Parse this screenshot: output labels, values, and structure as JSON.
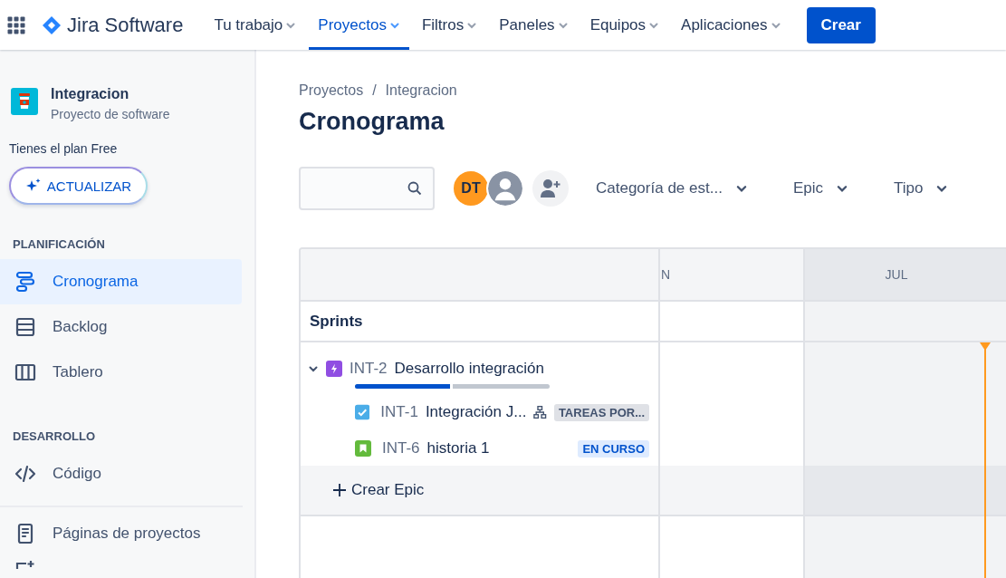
{
  "topbar": {
    "product": "Jira Software",
    "nav": [
      {
        "label": "Tu trabajo",
        "selected": false
      },
      {
        "label": "Proyectos",
        "selected": true
      },
      {
        "label": "Filtros",
        "selected": false
      },
      {
        "label": "Paneles",
        "selected": false
      },
      {
        "label": "Equipos",
        "selected": false
      },
      {
        "label": "Aplicaciones",
        "selected": false
      }
    ],
    "create_button": "Crear"
  },
  "sidebar": {
    "project": {
      "name": "Integracion",
      "type": "Proyecto de software"
    },
    "plan_note": "Tienes el plan Free",
    "upgrade_button": "ACTUALIZAR",
    "sections": [
      {
        "title": "PLANIFICACIÓN",
        "items": [
          {
            "label": "Cronograma",
            "kind": "timeline",
            "selected": true
          },
          {
            "label": "Backlog",
            "kind": "backlog",
            "selected": false
          },
          {
            "label": "Tablero",
            "kind": "board",
            "selected": false
          }
        ]
      },
      {
        "title": "DESARROLLO",
        "items": [
          {
            "label": "Código",
            "kind": "code",
            "selected": false
          }
        ]
      }
    ],
    "footer_items": [
      {
        "label": "Páginas de proyectos",
        "kind": "pages"
      }
    ]
  },
  "breadcrumbs": {
    "items": [
      "Proyectos",
      "Integracion"
    ],
    "separator": "/"
  },
  "page_title": "Cronograma",
  "toolbar": {
    "avatars": [
      {
        "initials": "DT",
        "kind": "initials"
      },
      {
        "kind": "generic"
      }
    ],
    "filters": [
      "Categoría de est...",
      "Epic",
      "Tipo"
    ]
  },
  "timeline": {
    "months": [
      {
        "label": "N",
        "shaded": false
      },
      {
        "label": "JUL",
        "shaded": true
      }
    ],
    "sprints_label": "Sprints",
    "epics": [
      {
        "key": "INT-2",
        "title": "Desarrollo integración",
        "expanded": true,
        "level": 0.5,
        "children": [
          {
            "key": "INT-1",
            "title": "Integración J...",
            "kind": "task",
            "has_subtasks": true,
            "status": {
              "label": "TAREAS POR...",
              "kind": "todo"
            }
          },
          {
            "key": "INT-6",
            "title": "historia 1",
            "kind": "story",
            "has_subtasks": false,
            "status": {
              "label": "EN CURSO",
              "kind": "inprogress"
            }
          }
        ]
      }
    ],
    "create_epic": "Crear Epic"
  }
}
